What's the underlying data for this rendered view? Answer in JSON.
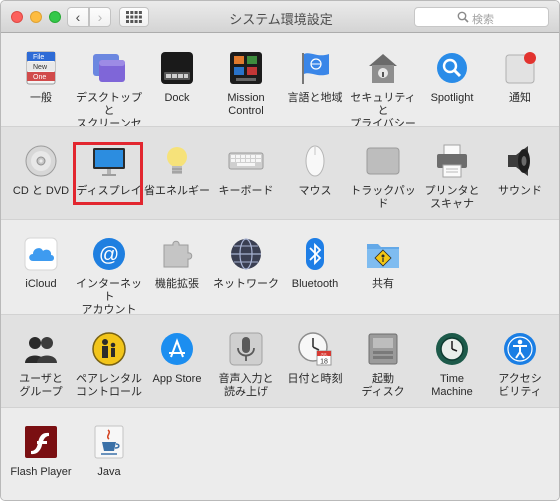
{
  "window": {
    "title": "システム環境設定"
  },
  "toolbar": {
    "back": "‹",
    "forward": "›"
  },
  "search": {
    "placeholder": "検索"
  },
  "rows": [
    [
      {
        "label": "一般"
      },
      {
        "label": "デスクトップと\nスクリーンセーバ"
      },
      {
        "label": "Dock"
      },
      {
        "label": "Mission\nControl"
      },
      {
        "label": "言語と地域"
      },
      {
        "label": "セキュリティと\nプライバシー"
      },
      {
        "label": "Spotlight"
      },
      {
        "label": "通知"
      }
    ],
    [
      {
        "label": "CD と DVD"
      },
      {
        "label": "ディスプレイ"
      },
      {
        "label": "省エネルギー"
      },
      {
        "label": "キーボード"
      },
      {
        "label": "マウス"
      },
      {
        "label": "トラックパッド"
      },
      {
        "label": "プリンタと\nスキャナ"
      },
      {
        "label": "サウンド"
      }
    ],
    [
      {
        "label": "iCloud"
      },
      {
        "label": "インターネット\nアカウント"
      },
      {
        "label": "機能拡張"
      },
      {
        "label": "ネットワーク"
      },
      {
        "label": "Bluetooth"
      },
      {
        "label": "共有"
      }
    ],
    [
      {
        "label": "ユーザと\nグループ"
      },
      {
        "label": "ペアレンタル\nコントロール"
      },
      {
        "label": "App Store"
      },
      {
        "label": "音声入力と\n読み上げ"
      },
      {
        "label": "日付と時刻"
      },
      {
        "label": "起動\nディスク"
      },
      {
        "label": "Time\nMachine"
      },
      {
        "label": "アクセシ\nビリティ"
      }
    ],
    [
      {
        "label": "Flash Player"
      },
      {
        "label": "Java"
      }
    ]
  ],
  "icon_text": {
    "general_file": "File",
    "general_new": "New",
    "general_one": "One",
    "date_month": "JUL",
    "date_day": "18"
  },
  "colors": {
    "highlight": "#e2262f",
    "accent": "#1e7ee6"
  }
}
